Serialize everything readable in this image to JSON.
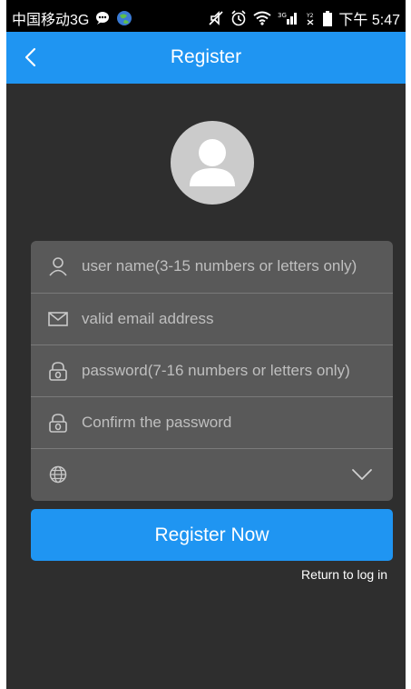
{
  "status_bar": {
    "carrier": "中国移动3G",
    "network": "3G",
    "time": "下午 5:47"
  },
  "header": {
    "title": "Register",
    "back_icon": "chevron-left-icon"
  },
  "avatar": {
    "icon": "user-avatar-icon"
  },
  "form": {
    "username": {
      "placeholder": "user name(3-15 numbers or letters only)",
      "icon": "user-icon"
    },
    "email": {
      "placeholder": "valid email address",
      "icon": "envelope-icon"
    },
    "password": {
      "placeholder": "password(7-16 numbers or letters only)",
      "icon": "lock-icon"
    },
    "confirm_password": {
      "placeholder": "Confirm the password",
      "icon": "lock-icon"
    },
    "region": {
      "value": "",
      "icon": "globe-icon",
      "dropdown_icon": "chevron-down-icon"
    }
  },
  "actions": {
    "register_label": "Register Now",
    "return_label": "Return to log in"
  },
  "colors": {
    "accent": "#1f95f2",
    "background": "#2e2e2e",
    "card": "#595959"
  }
}
